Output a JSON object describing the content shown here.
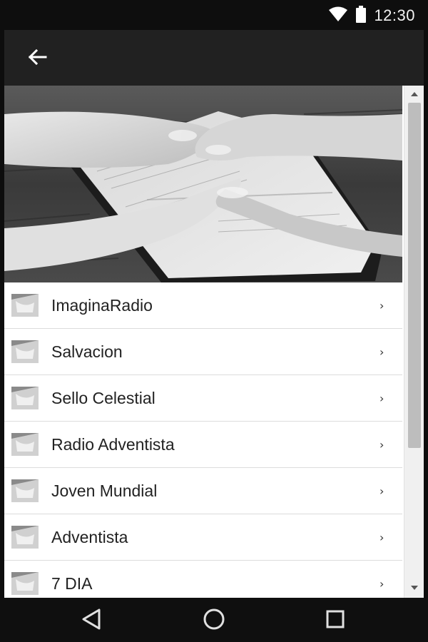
{
  "status_bar": {
    "time": "12:30",
    "icons": [
      "wifi-icon",
      "battery-icon"
    ]
  },
  "app_bar": {
    "back_icon": "arrow-back-icon"
  },
  "hero": {
    "description_icon": "praying-hands-on-bible-photo"
  },
  "stations": [
    {
      "label": "ImaginaRadio"
    },
    {
      "label": "Salvacion"
    },
    {
      "label": "Sello Celestial"
    },
    {
      "label": "Radio Adventista"
    },
    {
      "label": "Joven Mundial"
    },
    {
      "label": "Adventista"
    },
    {
      "label": "7 DIA"
    }
  ],
  "chevron": "›",
  "navigation_bar": {
    "icons": [
      "back-triangle-icon",
      "home-circle-icon",
      "recents-square-icon"
    ]
  },
  "colors": {
    "status_bar": "#0e0e0e",
    "app_bar": "#212121",
    "list_background": "#ffffff",
    "divider": "#dcdcdc",
    "nav_bar": "#0f0f0f"
  }
}
